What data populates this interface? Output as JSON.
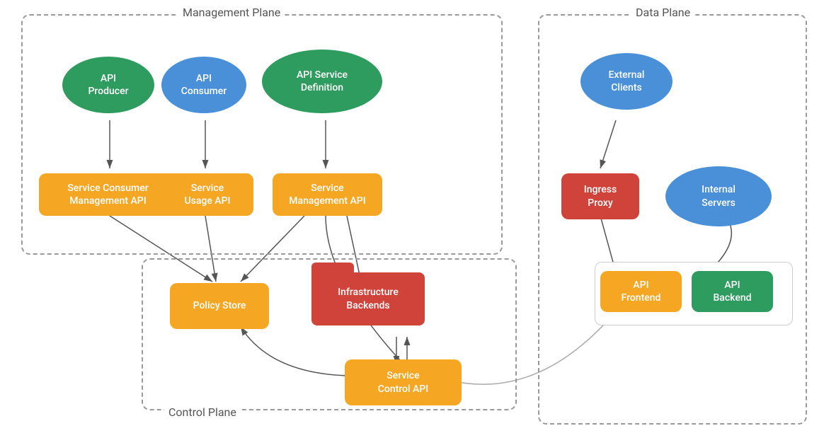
{
  "planes": {
    "management": {
      "label": "Management Plane"
    },
    "data": {
      "label": "Data Plane"
    },
    "control": {
      "label": "Control Plane"
    }
  },
  "nodes": {
    "api_producer": {
      "label": "API\nProducer"
    },
    "api_consumer": {
      "label": "API\nConsumer"
    },
    "api_service_def": {
      "label": "API Service\nDefinition"
    },
    "service_consumer_mgmt": {
      "label": "Service Consumer\nManagement API"
    },
    "service_usage": {
      "label": "Service\nUsage API"
    },
    "service_mgmt": {
      "label": "Service\nManagement API"
    },
    "policy_store": {
      "label": "Policy Store"
    },
    "infra_backends": {
      "label": "Infrastructure\nBackends"
    },
    "service_control": {
      "label": "Service\nControl API"
    },
    "external_clients": {
      "label": "External\nClients"
    },
    "ingress_proxy": {
      "label": "Ingress\nProxy"
    },
    "internal_servers": {
      "label": "Internal\nServers"
    },
    "api_frontend": {
      "label": "API\nFrontend"
    },
    "api_backend": {
      "label": "API\nBackend"
    }
  }
}
